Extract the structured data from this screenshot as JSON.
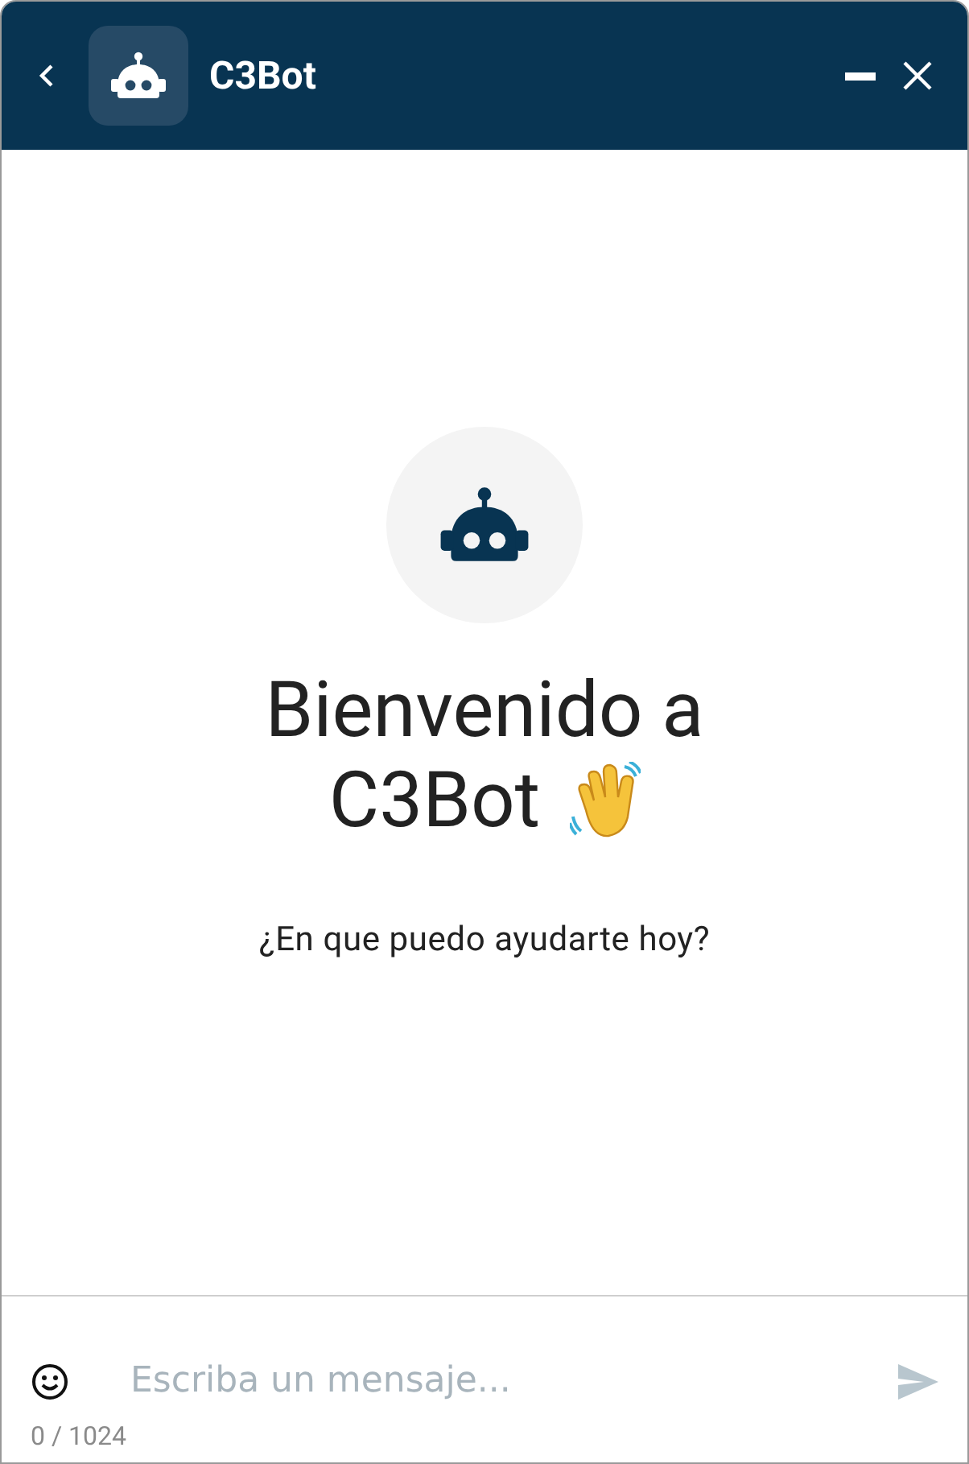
{
  "header": {
    "title": "C3Bot"
  },
  "welcome": {
    "title_lines": [
      "Bienvenido a",
      "C3Bot"
    ],
    "subtitle": "¿En que puedo ayudarte hoy?"
  },
  "composer": {
    "placeholder": "Escriba un mensaje...",
    "counter": "0 / 1024"
  }
}
